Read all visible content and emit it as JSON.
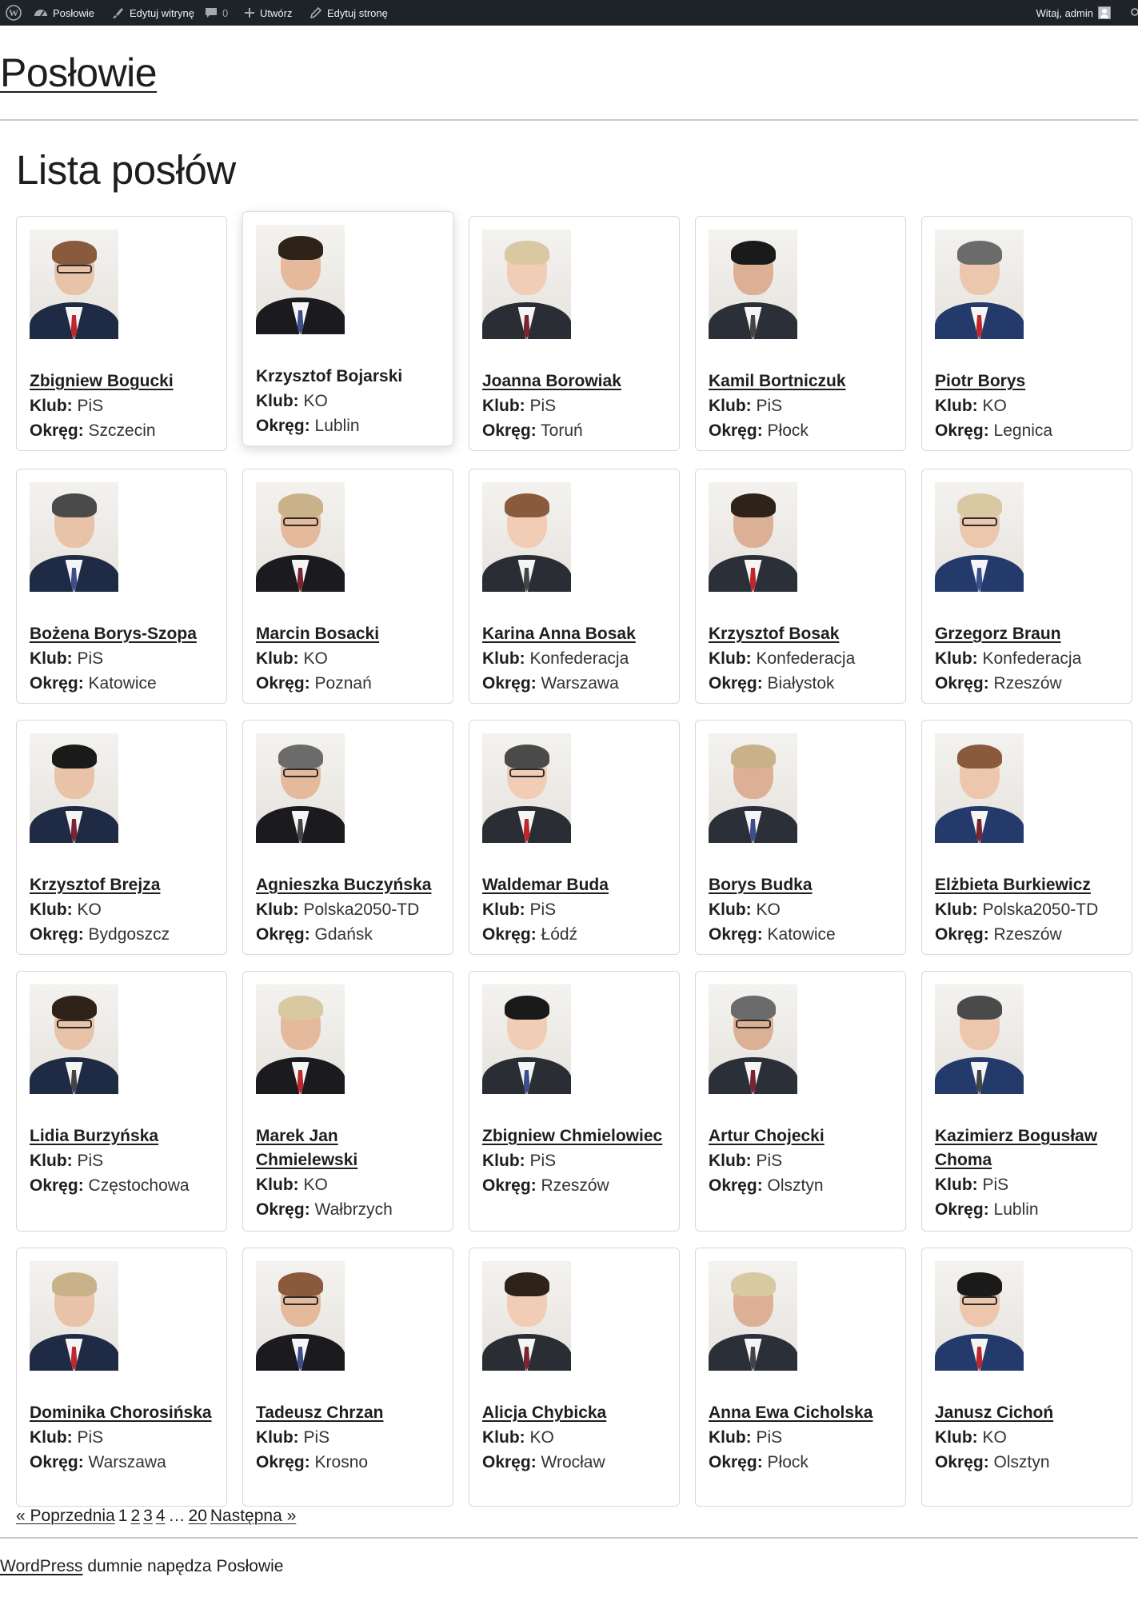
{
  "admin_bar": {
    "site_label": "Posłowie",
    "customize_label": "Edytuj witrynę",
    "comments_count": "0",
    "new_label": "Utwórz",
    "edit_label": "Edytuj stronę",
    "greeting": "Witaj, admin"
  },
  "site": {
    "title": "Posłowie"
  },
  "page": {
    "heading": "Lista posłów",
    "club_label": "Klub:",
    "district_label": "Okręg:"
  },
  "mps": [
    {
      "name": "Zbigniew Bogucki",
      "club": "PiS",
      "district": "Szczecin"
    },
    {
      "name": "Krzysztof Bojarski",
      "club": "KO",
      "district": "Lublin"
    },
    {
      "name": "Joanna Borowiak",
      "club": "PiS",
      "district": "Toruń"
    },
    {
      "name": "Kamil Bortniczuk",
      "club": "PiS",
      "district": "Płock"
    },
    {
      "name": "Piotr Borys",
      "club": "KO",
      "district": "Legnica"
    },
    {
      "name": "Bożena Borys-Szopa",
      "club": "PiS",
      "district": "Katowice"
    },
    {
      "name": "Marcin Bosacki",
      "club": "KO",
      "district": "Poznań"
    },
    {
      "name": "Karina Anna Bosak",
      "club": "Konfederacja",
      "district": "Warszawa"
    },
    {
      "name": "Krzysztof Bosak",
      "club": "Konfederacja",
      "district": "Białystok"
    },
    {
      "name": "Grzegorz Braun",
      "club": "Konfederacja",
      "district": "Rzeszów"
    },
    {
      "name": "Krzysztof Brejza",
      "club": "KO",
      "district": "Bydgoszcz"
    },
    {
      "name": "Agnieszka Buczyńska",
      "club": "Polska2050-TD",
      "district": "Gdańsk"
    },
    {
      "name": "Waldemar Buda",
      "club": "PiS",
      "district": "Łódź"
    },
    {
      "name": "Borys Budka",
      "club": "KO",
      "district": "Katowice"
    },
    {
      "name": "Elżbieta Burkiewicz",
      "club": "Polska2050-TD",
      "district": "Rzeszów"
    },
    {
      "name": "Lidia Burzyńska",
      "club": "PiS",
      "district": "Częstochowa"
    },
    {
      "name": "Marek Jan Chmielewski",
      "club": "KO",
      "district": "Wałbrzych"
    },
    {
      "name": "Zbigniew Chmielowiec",
      "club": "PiS",
      "district": "Rzeszów"
    },
    {
      "name": "Artur Chojecki",
      "club": "PiS",
      "district": "Olsztyn"
    },
    {
      "name": "Kazimierz Bogusław Choma",
      "club": "PiS",
      "district": "Lublin"
    },
    {
      "name": "Dominika Chorosińska",
      "club": "PiS",
      "district": "Warszawa"
    },
    {
      "name": "Tadeusz Chrzan",
      "club": "PiS",
      "district": "Krosno"
    },
    {
      "name": "Alicja Chybicka",
      "club": "KO",
      "district": "Wrocław"
    },
    {
      "name": "Anna Ewa Cicholska",
      "club": "PiS",
      "district": "Płock"
    },
    {
      "name": "Janusz Cichoń",
      "club": "KO",
      "district": "Olsztyn"
    }
  ],
  "pagination": {
    "prev": "« Poprzednia",
    "pages": [
      "1",
      "2",
      "3",
      "4"
    ],
    "ellipsis": "…",
    "last": "20",
    "next": "Następna »"
  },
  "footer": {
    "link": "WordPress",
    "text": "dumnie napędza Posłowie"
  }
}
